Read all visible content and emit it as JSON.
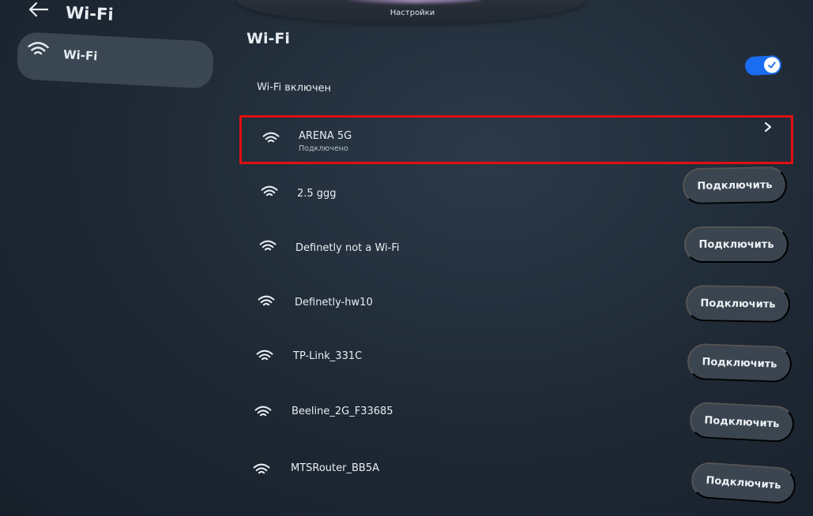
{
  "topbar": {
    "label": "Настройки"
  },
  "sidebar": {
    "title": "Wi-Fi",
    "items": [
      {
        "label": "Wi-Fi"
      }
    ]
  },
  "main": {
    "title": "Wi-Fi",
    "toggle": {
      "label": "Wi-Fi включен",
      "state": "on"
    },
    "networks": [
      {
        "name": "ARENA 5G",
        "status": "Подключено"
      },
      {
        "name": "2.5 ggg",
        "action": "Подключить"
      },
      {
        "name": "Definetly not a Wi-Fi",
        "action": "Подключить"
      },
      {
        "name": "Definetly-hw10",
        "action": "Подключить"
      },
      {
        "name": "TP-Link_331C",
        "action": "Подключить"
      },
      {
        "name": "Beeline_2G_F33685",
        "action": "Подключить"
      },
      {
        "name": "MTSRouter_BB5A",
        "action": "Подключить"
      }
    ]
  },
  "colors": {
    "accent": "#1a6cf0",
    "highlight": "#e01010",
    "button_bg": "#3a4550",
    "background": "#1e2834"
  }
}
